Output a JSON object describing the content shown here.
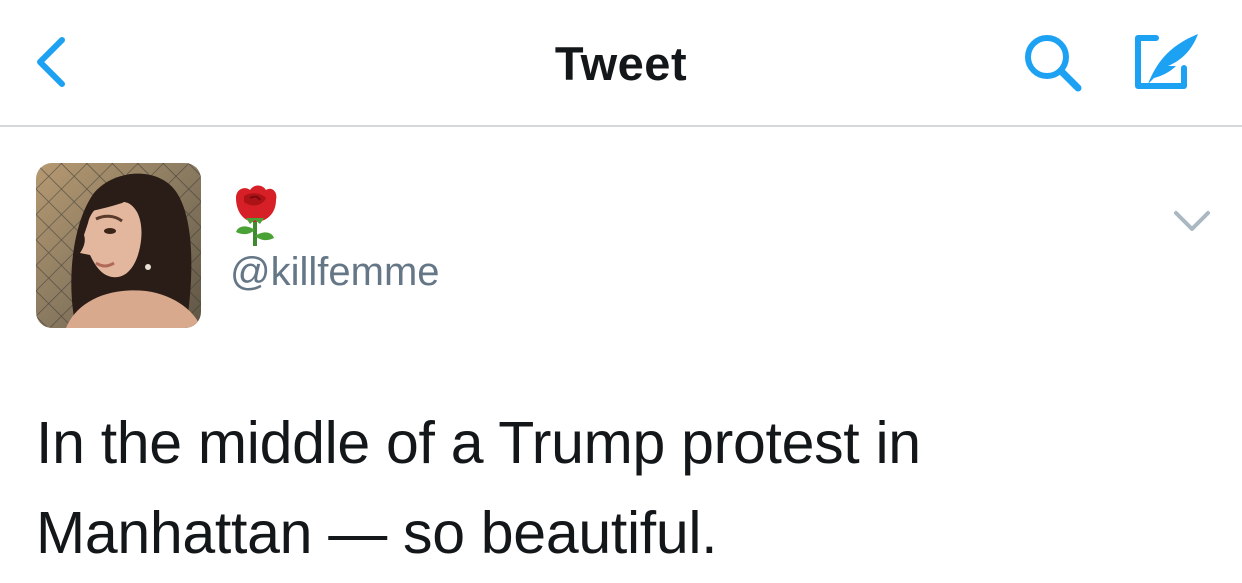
{
  "navbar": {
    "back_icon": "chevron-left-icon",
    "title": "Tweet",
    "search_icon": "search-icon",
    "compose_icon": "compose-tweet-icon"
  },
  "tweet": {
    "display_name_icon": "rose-emoji-icon",
    "handle": "@killfemme",
    "menu_icon": "chevron-down-icon",
    "text": "In the middle of a Trump protest in Manhattan — so beautiful."
  },
  "colors": {
    "accent": "#1da1f2",
    "text_primary": "#14171a",
    "text_secondary": "#657786",
    "divider": "#d6d9dc",
    "caret": "#aab8c2"
  }
}
